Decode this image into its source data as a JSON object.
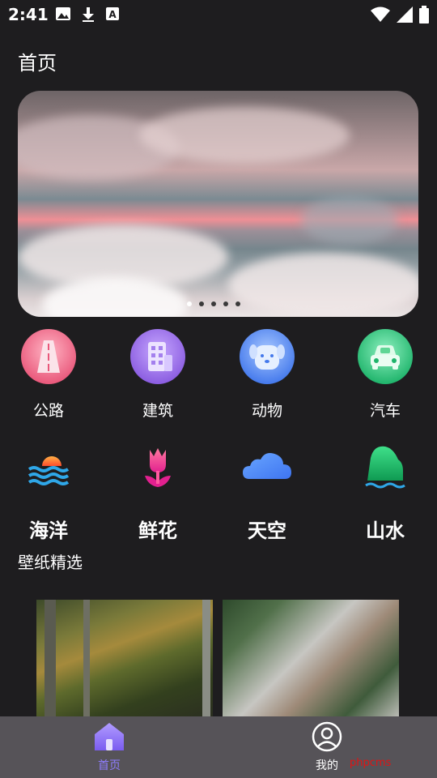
{
  "status_bar": {
    "time": "2:41",
    "left_icons": [
      "image-icon",
      "download-icon",
      "a-box-icon"
    ],
    "right_icons": [
      "wifi-icon",
      "signal-icon",
      "battery-icon"
    ]
  },
  "page_title": "首页",
  "banner": {
    "dots": 5,
    "active_dot": 0
  },
  "categories_row1": [
    {
      "label": "公路",
      "icon": "road-icon",
      "color": "#ef6b86"
    },
    {
      "label": "建筑",
      "icon": "building-icon",
      "color": "#9c73ea"
    },
    {
      "label": "动物",
      "icon": "dog-icon",
      "color": "#5a8cf3"
    },
    {
      "label": "汽车",
      "icon": "car-icon",
      "color": "#2ec47e"
    }
  ],
  "categories_row2": [
    {
      "label": "海洋",
      "icon": "sea-sunset-icon"
    },
    {
      "label": "鲜花",
      "icon": "flower-icon"
    },
    {
      "label": "天空",
      "icon": "cloud-icon"
    },
    {
      "label": "山水",
      "icon": "mountain-water-icon"
    }
  ],
  "section_title": "壁纸精选",
  "tabbar": {
    "home_label": "首页",
    "mine_label": "我的",
    "active_color": "#8f7dff"
  },
  "watermark": "phpcms"
}
